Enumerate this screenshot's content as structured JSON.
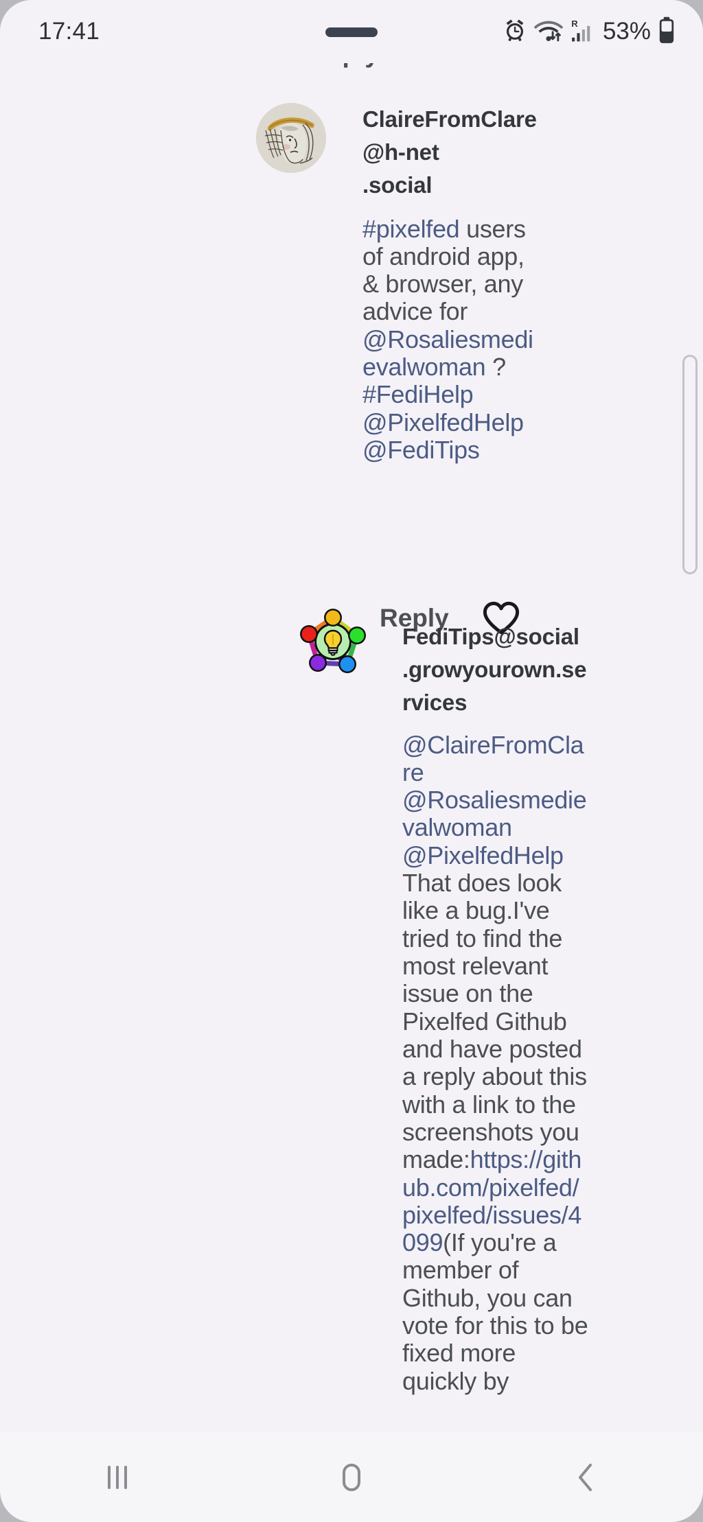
{
  "status_bar": {
    "clock": "17:41",
    "battery_percent": "53%",
    "icons": [
      "alarm-icon",
      "wifi-icon",
      "roaming-signal-icon",
      "battery-icon"
    ]
  },
  "partial_top": {
    "reply_label": "Reply",
    "chevron": "chevron-down-icon"
  },
  "posts": [
    {
      "author": "ClaireFromClare@h-net.social",
      "author_line1": "ClaireFromClare@h-net",
      "author_line2": ".social",
      "avatar": "medieval-woman-illustration-avatar",
      "segments": [
        {
          "text": "#pixelfed",
          "link": true
        },
        {
          "text": " users of android app, & browser, any advice for ",
          "link": false
        },
        {
          "text": "@Rosaliesmedievalwoman",
          "link": true
        },
        {
          "text": " ?",
          "link": false
        },
        {
          "text": "#FediHelp",
          "link": true
        },
        {
          "text": " ",
          "link": false
        },
        {
          "text": "@PixelfedHelp",
          "link": true
        },
        {
          "text": " ",
          "link": false
        },
        {
          "text": "@FediTips",
          "link": true
        }
      ],
      "reply_label": "Reply",
      "like_icon": "heart-icon"
    },
    {
      "author": "FediTips@social.growyourown.services",
      "author_line1": "FediTips@social",
      "author_line2": ".growyourown.services",
      "avatar": "fediverse-network-lightbulb-avatar",
      "segments": [
        {
          "text": "@ClaireFromClare",
          "link": true
        },
        {
          "text": " ",
          "link": false
        },
        {
          "text": "@Rosaliesmedievalwoman",
          "link": true
        },
        {
          "text": " ",
          "link": false
        },
        {
          "text": "@PixelfedHelp",
          "link": true
        },
        {
          "text": " That does look like a bug.I've tried to find the most relevant issue on the Pixelfed Github and have posted a reply about this with a link to the screenshots you made:",
          "link": false
        },
        {
          "text": "https://github.com/pixelfed/pixelfed/issues/4099",
          "link": true
        },
        {
          "text": "(If you're a member of Github, you can vote for this to be fixed more quickly by",
          "link": false
        }
      ]
    }
  ],
  "nav_bar": {
    "recents_label": "recents-icon",
    "home_label": "home-icon",
    "back_label": "back-icon"
  },
  "colors": {
    "background": "#f4f2f7",
    "link": "#4c5b84",
    "text": "#4b4e53",
    "author": "#34373c"
  }
}
